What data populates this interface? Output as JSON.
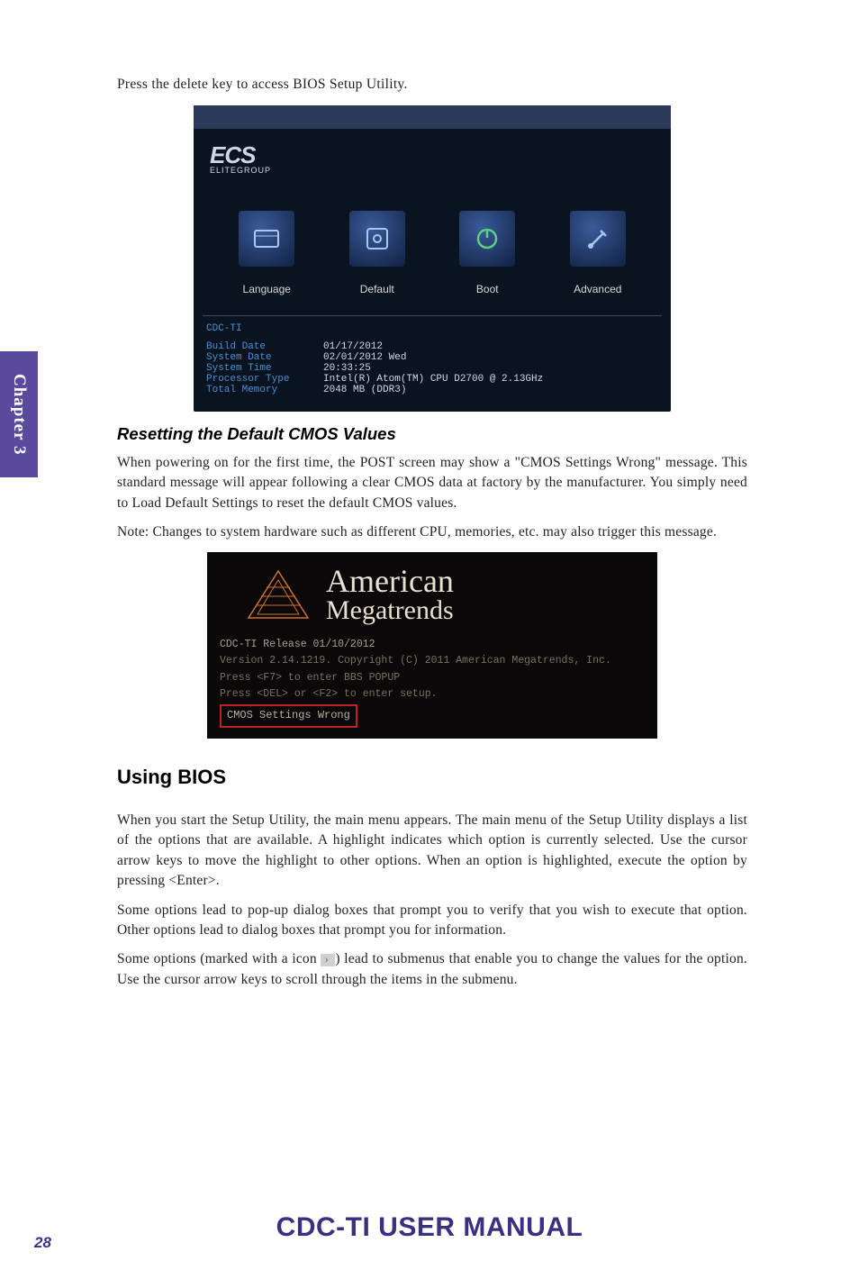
{
  "chapter_tab": "Chapter 3",
  "intro_line": "Press the delete key to access BIOS Setup Utility.",
  "bios": {
    "logo_main": "ECS",
    "logo_sub": "ELITEGROUP",
    "icons": [
      {
        "label": "Language"
      },
      {
        "label": "Default"
      },
      {
        "label": "Boot"
      },
      {
        "label": "Advanced"
      }
    ],
    "model": "CDC-TI",
    "info": [
      {
        "label": "Build Date",
        "value": "01/17/2012"
      },
      {
        "label": "System Date",
        "value": "02/01/2012 Wed"
      },
      {
        "label": "System Time",
        "value": "20:33:25"
      },
      {
        "label": "Processor Type",
        "value": "Intel(R) Atom(TM) CPU D2700   @ 2.13GHz"
      },
      {
        "label": "Total Memory",
        "value": "2048 MB (DDR3)"
      }
    ]
  },
  "subheading_reset": "Resetting the Default CMOS Values",
  "para_reset_1": "When powering on for the first time, the POST screen may show a \"CMOS Settings Wrong\" message. This standard message will appear following a clear CMOS data at factory by the manufacturer. You simply need to Load Default Settings to reset the default CMOS values.",
  "para_reset_2": "Note: Changes to system hardware such as different CPU, memories, etc. may also trigger this message.",
  "ami": {
    "name_1": "American",
    "name_2": "Megatrends",
    "line1": "CDC-TI  Release  01/10/2012",
    "line2": "Version 2.14.1219. Copyright (C) 2011 American Megatrends, Inc.",
    "line3": "Press <F7> to enter BBS POPUP",
    "line4": "Press <DEL> or <F2> to enter setup.",
    "cmos_box": "CMOS Settings Wrong"
  },
  "h2_using": "Using BIOS",
  "para_using_1": "When you start the Setup Utility, the main menu appears. The main menu of the Setup Utility displays a list of the options that are available. A highlight indicates which option is currently selected. Use the cursor arrow keys to move the highlight to other options. When an option is highlighted, execute the option by pressing <Enter>.",
  "para_using_2": "Some options lead to pop-up dialog boxes that prompt you to verify that you wish to execute that option. Other options lead to dialog boxes that prompt you for information.",
  "para_using_3a": "Some options (marked with a icon ",
  "para_using_3b": ") lead to submenus that enable you to change the values for the option. Use the cursor arrow keys to scroll through the items in the submenu.",
  "footer_title": "CDC-TI USER MANUAL",
  "page_num": "28"
}
